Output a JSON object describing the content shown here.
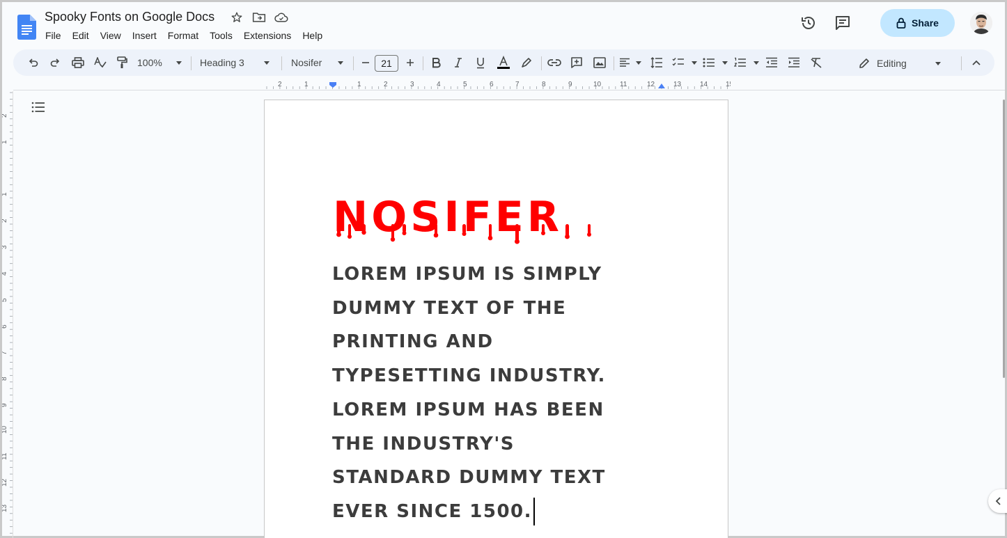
{
  "document": {
    "title": "Spooky Fonts on Google Docs",
    "heading": "NOSIFER",
    "body": "LOREM IPSUM IS SIMPLY DUMMY TEXT OF THE PRINTING AND TYPESETTING INDUSTRY. LOREM IPSUM HAS BEEN THE INDUSTRY'S STANDARD DUMMY TEXT EVER SINCE 1500.",
    "body_lines": [
      "LOREM IPSUM IS SIMPLY",
      "DUMMY TEXT OF THE",
      "PRINTING AND",
      "TYPESETTING INDUSTRY.",
      "LOREM IPSUM HAS BEEN",
      "THE INDUSTRY'S",
      "STANDARD DUMMY TEXT",
      "EVER SINCE 1500."
    ],
    "heading_color": "#ff0000",
    "body_color": "#3c3c3c"
  },
  "menu": [
    "File",
    "Edit",
    "View",
    "Insert",
    "Format",
    "Tools",
    "Extensions",
    "Help"
  ],
  "share": {
    "label": "Share"
  },
  "toolbar": {
    "zoom": "100%",
    "style": "Heading 3",
    "font": "Nosifer",
    "font_size": "21",
    "mode": "Editing"
  },
  "ruler": {
    "horizontal": [
      "2",
      "1",
      "1",
      "2",
      "3",
      "4",
      "5",
      "6",
      "7",
      "8",
      "9",
      "10",
      "11",
      "12",
      "13",
      "14",
      "15"
    ],
    "vertical": [
      "2",
      "1",
      "1",
      "2",
      "3",
      "4",
      "5",
      "6",
      "7",
      "8",
      "9",
      "10",
      "11",
      "12",
      "13"
    ]
  },
  "colors": {
    "accent": "#0b57d0",
    "share_bg": "#c2e7ff",
    "toolbar_bg": "#edf2fa",
    "doc_icon": "#4285f4"
  }
}
